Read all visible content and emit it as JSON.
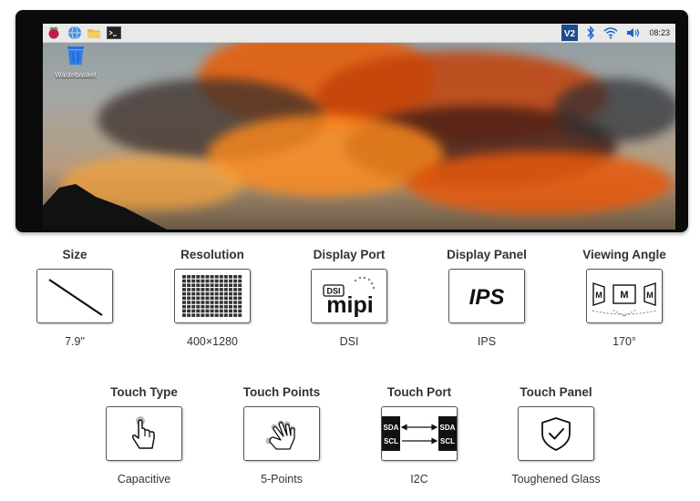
{
  "desktop": {
    "wastebasket_label": "Wastebasket",
    "clock": "08:23"
  },
  "specs_row1": [
    {
      "title": "Size",
      "value": "7.9\""
    },
    {
      "title": "Resolution",
      "value": "400×1280"
    },
    {
      "title": "Display Port",
      "value": "DSI"
    },
    {
      "title": "Display Panel",
      "value": "IPS"
    },
    {
      "title": "Viewing Angle",
      "value": "170°"
    }
  ],
  "specs_row2": [
    {
      "title": "Touch Type",
      "value": "Capacitive"
    },
    {
      "title": "Touch Points",
      "value": "5-Points"
    },
    {
      "title": "Touch Port",
      "value": "I2C"
    },
    {
      "title": "Touch Panel",
      "value": "Toughened Glass"
    }
  ],
  "icon_text": {
    "dsi": "DSI",
    "mipi": "mipi",
    "ips": "IPS",
    "m": "M",
    "sda": "SDA",
    "scl": "SCL"
  }
}
